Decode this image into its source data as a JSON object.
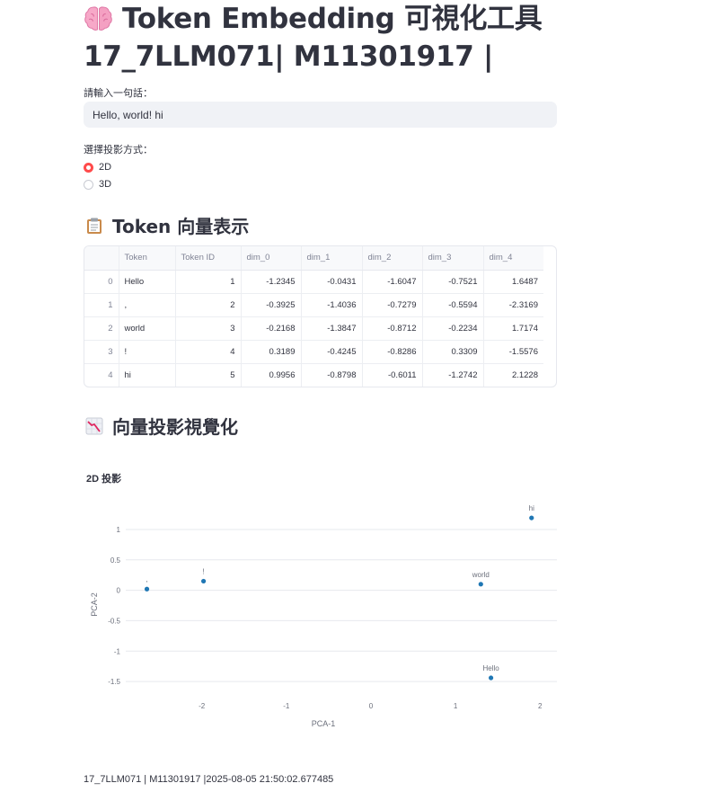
{
  "header": {
    "title_line1": "Token Embedding 可視化工具",
    "title_line2": "17_7LLM071| M11301917 |",
    "title_icon": "brain-emoji-icon"
  },
  "input": {
    "label": "請輸入一句話：",
    "value": "Hello, world! hi"
  },
  "projection": {
    "label": "選擇投影方式：",
    "options": [
      {
        "label": "2D",
        "selected": true
      },
      {
        "label": "3D",
        "selected": false
      }
    ]
  },
  "vectors_section": {
    "title": "Token 向量表示",
    "icon": "clipboard-icon"
  },
  "table": {
    "columns": [
      "",
      "Token",
      "Token ID",
      "dim_0",
      "dim_1",
      "dim_2",
      "dim_3",
      "dim_4"
    ],
    "rows": [
      {
        "index": "0",
        "token": "Hello",
        "id": "1",
        "dims": [
          "-1.2345",
          "-0.0431",
          "-1.6047",
          "-0.7521",
          "1.6487"
        ]
      },
      {
        "index": "1",
        "token": ",",
        "id": "2",
        "dims": [
          "-0.3925",
          "-1.4036",
          "-0.7279",
          "-0.5594",
          "-2.3169"
        ]
      },
      {
        "index": "2",
        "token": "world",
        "id": "3",
        "dims": [
          "-0.2168",
          "-1.3847",
          "-0.8712",
          "-0.2234",
          "1.7174"
        ]
      },
      {
        "index": "3",
        "token": "!",
        "id": "4",
        "dims": [
          "0.3189",
          "-0.4245",
          "-0.8286",
          "0.3309",
          "-1.5576"
        ]
      },
      {
        "index": "4",
        "token": "hi",
        "id": "5",
        "dims": [
          "0.9956",
          "-0.8798",
          "-0.6011",
          "-1.2742",
          "2.1228"
        ]
      }
    ]
  },
  "viz_section": {
    "title": "向量投影視覺化",
    "icon": "chart-decreasing-icon"
  },
  "chart_data": {
    "type": "scatter",
    "title": "2D 投影",
    "xlabel": "PCA-1",
    "ylabel": "PCA-2",
    "xlim": [
      -2.9,
      2.2
    ],
    "ylim": [
      -1.75,
      1.28
    ],
    "xticks": [
      -2,
      -1,
      0,
      1,
      2
    ],
    "yticks": [
      -1.5,
      -1,
      -0.5,
      0,
      0.5,
      1
    ],
    "xtick_labels": [
      "-2",
      "-1",
      "0",
      "1",
      "2"
    ],
    "ytick_labels": [
      "-1.5",
      "-1",
      "-0.5",
      "0",
      "0.5",
      "1"
    ],
    "grid": true,
    "marker_color": "#1f77b4",
    "points": [
      {
        "label": "Hello",
        "x": 1.42,
        "y": -1.44
      },
      {
        "label": ",",
        "x": -2.65,
        "y": 0.02
      },
      {
        "label": "world",
        "x": 1.3,
        "y": 0.1
      },
      {
        "label": "!",
        "x": -1.98,
        "y": 0.15
      },
      {
        "label": "hi",
        "x": 1.9,
        "y": 1.19
      }
    ]
  },
  "footer": {
    "text": "17_7LLM071 | M11301917 |2025-08-05 21:50:02.677485"
  }
}
